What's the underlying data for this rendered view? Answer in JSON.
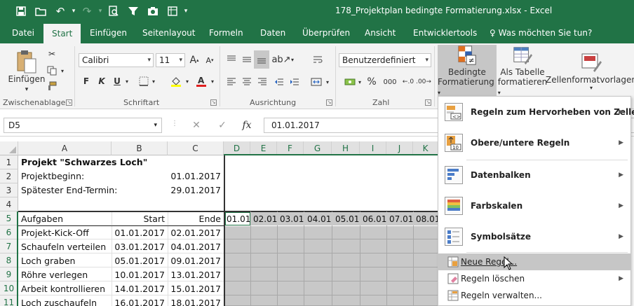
{
  "titlebar": {
    "title": "178_Projektplan bedingte Formatierung.xlsx  -  Excel",
    "qat_icons": [
      "save-icon",
      "open-folder-icon",
      "undo-icon",
      "redo-icon",
      "print-preview-icon",
      "filter-icon",
      "camera-icon",
      "sheet-icon",
      "customize-icon"
    ]
  },
  "tabs": [
    "Datei",
    "Start",
    "Einfügen",
    "Seitenlayout",
    "Formeln",
    "Daten",
    "Überprüfen",
    "Ansicht",
    "Entwicklertools",
    "Was möchten Sie tun?"
  ],
  "active_tab": "Start",
  "ribbon": {
    "clipboard": {
      "paste_label": "Einfügen",
      "group_label": "Zwischenablage"
    },
    "font": {
      "font_name": "Calibri",
      "font_size": "11",
      "bold": "F",
      "italic": "K",
      "underline": "U",
      "group_label": "Schriftart",
      "font_color": "#e02020",
      "fill_color": "#ffff00"
    },
    "alignment": {
      "group_label": "Ausrichtung"
    },
    "number": {
      "format": "Benutzerdefiniert",
      "percent": "%",
      "thousands": "000",
      "group_label": "Zahl"
    },
    "styles": {
      "cond_format_line1": "Bedingte",
      "cond_format_line2": "Formatierung",
      "as_table_line1": "Als Tabelle",
      "as_table_line2": "formatieren",
      "cell_styles": "Zellenformatvorlagen"
    }
  },
  "formula_bar": {
    "name_box": "D5",
    "fx": "fx",
    "content": "01.01.2017"
  },
  "columns": [
    "A",
    "B",
    "C",
    "D",
    "E",
    "F",
    "G",
    "H",
    "I",
    "J",
    "K"
  ],
  "rows": [
    "1",
    "2",
    "3",
    "4",
    "5",
    "6",
    "7",
    "8",
    "9",
    "10",
    "11"
  ],
  "cells": {
    "a1": "Projekt \"Schwarzes Loch\"",
    "a2": "Projektbeginn:",
    "c2": "01.01.2017",
    "a3": "Spätester End-Termin:",
    "c3": "29.01.2017",
    "header": {
      "a": "Aufgaben",
      "b": "Start",
      "c": "Ende"
    },
    "dates": [
      "01.01",
      "02.01",
      "03.01",
      "04.01",
      "05.01",
      "06.01",
      "07.01",
      "08.01"
    ],
    "tasks": [
      {
        "name": "Projekt-Kick-Off",
        "start": "01.01.2017",
        "end": "02.01.2017"
      },
      {
        "name": "Schaufeln verteilen",
        "start": "03.01.2017",
        "end": "04.01.2017"
      },
      {
        "name": "Loch graben",
        "start": "05.01.2017",
        "end": "09.01.2017"
      },
      {
        "name": "Röhre verlegen",
        "start": "10.01.2017",
        "end": "13.01.2017"
      },
      {
        "name": "Arbeit kontrollieren",
        "start": "14.01.2017",
        "end": "15.01.2017"
      },
      {
        "name": "Loch zuschaufeln",
        "start": "16.01.2017",
        "end": "18.01.2017"
      }
    ]
  },
  "menu": {
    "items": [
      {
        "label": "Regeln zum Hervorheben von Zellen",
        "icon": "highlight-rules-icon",
        "submenu": true
      },
      {
        "label": "Obere/untere Regeln",
        "icon": "top-bottom-rules-icon",
        "submenu": true
      },
      {
        "label": "Datenbalken",
        "icon": "data-bars-icon",
        "submenu": true
      },
      {
        "label": "Farbskalen",
        "icon": "color-scales-icon",
        "submenu": true
      },
      {
        "label": "Symbolsätze",
        "icon": "icon-sets-icon",
        "submenu": true
      },
      {
        "label": "Neue Regel...",
        "icon": "new-rule-icon",
        "submenu": false
      },
      {
        "label": "Regeln löschen",
        "icon": "clear-rules-icon",
        "submenu": true
      },
      {
        "label": "Regeln verwalten...",
        "icon": "manage-rules-icon",
        "submenu": false
      }
    ],
    "hovered": "Neue Regel..."
  },
  "colors": {
    "excel_green": "#217346",
    "ribbon_bg": "#f3f3f3",
    "hover_gray": "#c6c6c6"
  }
}
